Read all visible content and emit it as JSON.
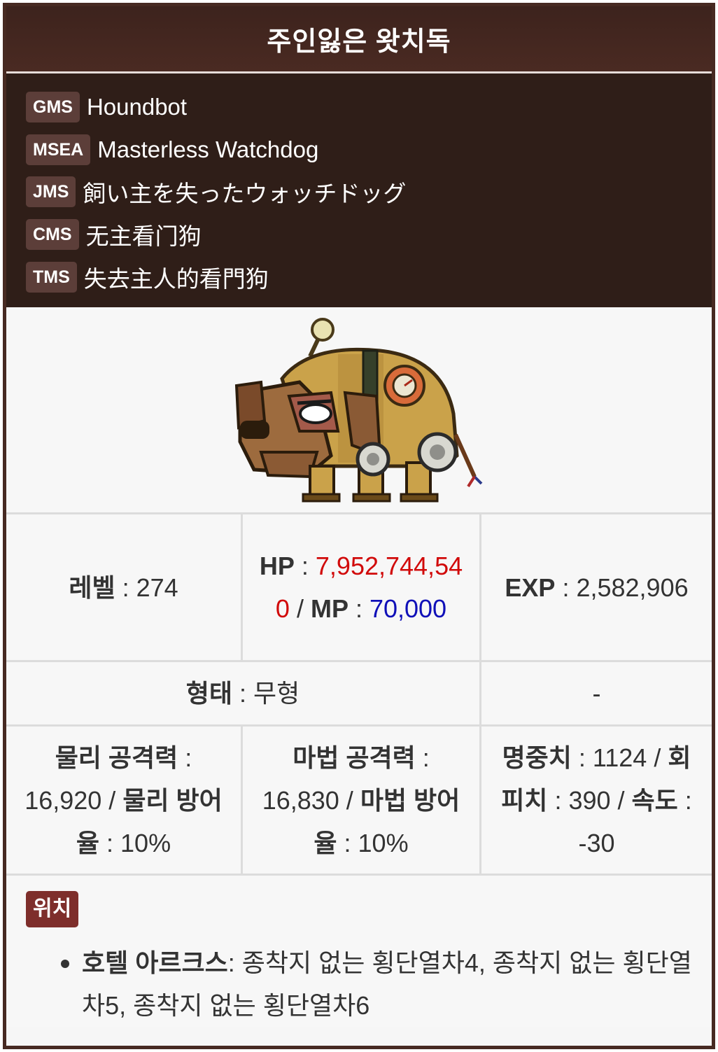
{
  "title": "주인잃은 왓치독",
  "names": [
    {
      "region": "GMS",
      "name": "Houndbot"
    },
    {
      "region": "MSEA",
      "name": "Masterless Watchdog"
    },
    {
      "region": "JMS",
      "name": "飼い主を失ったウォッチドッグ"
    },
    {
      "region": "CMS",
      "name": "无主看门狗"
    },
    {
      "region": "TMS",
      "name": "失去主人的看門狗"
    }
  ],
  "stats": {
    "level_label": "레벨",
    "level_value": "274",
    "hp_label": "HP",
    "hp_value": "7,952,744,540",
    "mp_label": "MP",
    "mp_value": "70,000",
    "exp_label": "EXP",
    "exp_value": "2,582,906",
    "form_label": "형태",
    "form_value": "무형",
    "empty_value": "-",
    "phys_atk_label": "물리 공격력",
    "phys_atk_value": "16,920",
    "phys_def_label": "물리 방어율",
    "phys_def_value": "10%",
    "mag_atk_label": "마법 공격력",
    "mag_atk_value": "16,830",
    "mag_def_label": "마법 방어율",
    "mag_def_value": "10%",
    "accuracy_label": "명중치",
    "accuracy_value": "1124",
    "evasion_label": "회피치",
    "evasion_value": "390",
    "speed_label": "속도",
    "speed_value": "-30"
  },
  "location": {
    "tag": "위치",
    "items": [
      {
        "place": "호텔 아르크스",
        "maps": "종착지 없는 횡단열차4, 종착지 없는 횡단열차5, 종착지 없는 횡단열차6"
      }
    ]
  }
}
